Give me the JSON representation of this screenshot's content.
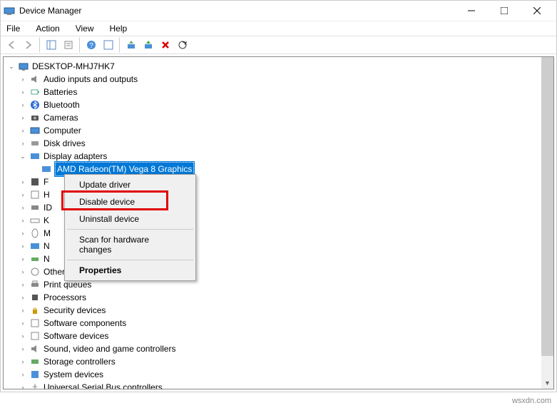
{
  "window": {
    "title": "Device Manager"
  },
  "menubar": [
    "File",
    "Action",
    "View",
    "Help"
  ],
  "tree": {
    "root": "DESKTOP-MHJ7HK7",
    "items": [
      "Audio inputs and outputs",
      "Batteries",
      "Bluetooth",
      "Cameras",
      "Computer",
      "Disk drives"
    ],
    "display_adapters": "Display adapters",
    "selected_device": "AMD Radeon(TM) Vega 8 Graphics",
    "partial": [
      "F",
      "H",
      "ID",
      "K",
      "M",
      "N",
      "N"
    ],
    "rest": [
      "Other devices",
      "Print queues",
      "Processors",
      "Security devices",
      "Software components",
      "Software devices",
      "Sound, video and game controllers",
      "Storage controllers",
      "System devices",
      "Universal Serial Bus controllers"
    ]
  },
  "context_menu": {
    "update": "Update driver",
    "disable": "Disable device",
    "uninstall": "Uninstall device",
    "scan": "Scan for hardware changes",
    "properties": "Properties"
  },
  "watermark": "wsxdn.com"
}
